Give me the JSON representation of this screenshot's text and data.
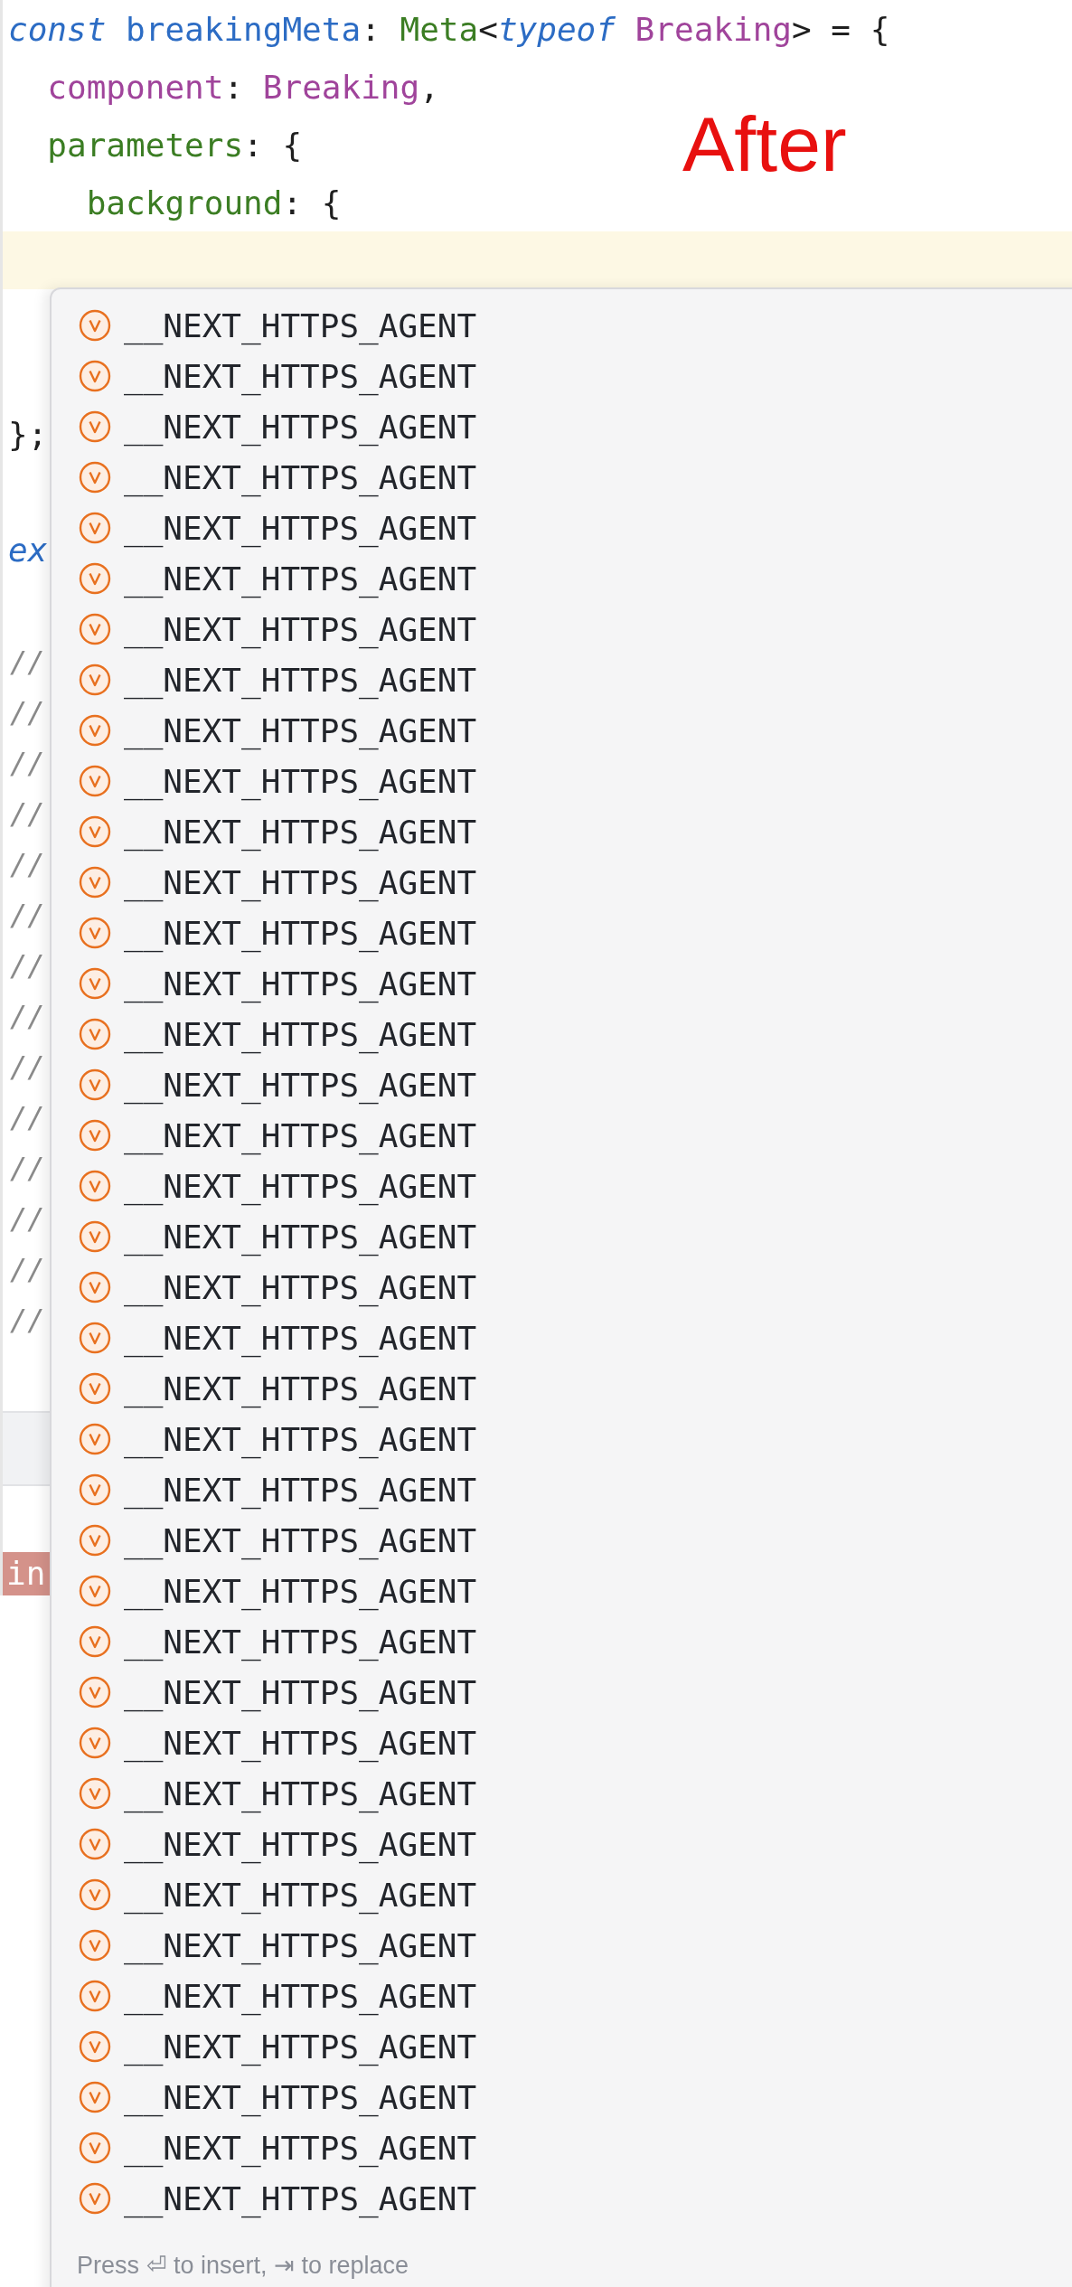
{
  "editor": {
    "code_lines": [
      {
        "current": false,
        "tokens": [
          {
            "text": "const ",
            "kind": "keyword"
          },
          {
            "text": "breakingMeta",
            "kind": "variable"
          },
          {
            "text": ": ",
            "kind": "punct"
          },
          {
            "text": "Meta",
            "kind": "type"
          },
          {
            "text": "<",
            "kind": "punct"
          },
          {
            "text": "typeof ",
            "kind": "keyword"
          },
          {
            "text": "Breaking",
            "kind": "field"
          },
          {
            "text": "> = {",
            "kind": "punct"
          }
        ]
      },
      {
        "current": false,
        "tokens": [
          {
            "text": "  component",
            "kind": "field"
          },
          {
            "text": ": ",
            "kind": "punct"
          },
          {
            "text": "Breaking",
            "kind": "field"
          },
          {
            "text": ",",
            "kind": "punct"
          }
        ]
      },
      {
        "current": false,
        "tokens": [
          {
            "text": "  parameters",
            "kind": "property"
          },
          {
            "text": ": {",
            "kind": "punct"
          }
        ]
      },
      {
        "current": false,
        "tokens": [
          {
            "text": "    background",
            "kind": "property"
          },
          {
            "text": ": {",
            "kind": "punct"
          }
        ]
      },
      {
        "current": true
      },
      {
        "current": false
      },
      {
        "current": false
      },
      {
        "current": false,
        "tokens": [
          {
            "text": "};",
            "kind": "punct"
          }
        ]
      },
      {
        "current": false
      },
      {
        "current": false,
        "tokens": [
          {
            "text": "ex",
            "kind": "keyword"
          }
        ]
      },
      {
        "current": false
      }
    ],
    "comment_lines": [
      "//",
      "//",
      "//",
      "//",
      "//",
      "//",
      "//",
      "//",
      "//",
      "//",
      "//",
      "//",
      "//",
      "//"
    ],
    "badge": "in"
  },
  "annotation": "After",
  "completion_popup": {
    "items": [
      {
        "label": "__NEXT_HTTPS_AGENT",
        "kind": "variable"
      },
      {
        "label": "__NEXT_HTTPS_AGENT",
        "kind": "variable"
      },
      {
        "label": "__NEXT_HTTPS_AGENT",
        "kind": "variable"
      },
      {
        "label": "__NEXT_HTTPS_AGENT",
        "kind": "variable"
      },
      {
        "label": "__NEXT_HTTPS_AGENT",
        "kind": "variable"
      },
      {
        "label": "__NEXT_HTTPS_AGENT",
        "kind": "variable"
      },
      {
        "label": "__NEXT_HTTPS_AGENT",
        "kind": "variable"
      },
      {
        "label": "__NEXT_HTTPS_AGENT",
        "kind": "variable"
      },
      {
        "label": "__NEXT_HTTPS_AGENT",
        "kind": "variable"
      },
      {
        "label": "__NEXT_HTTPS_AGENT",
        "kind": "variable"
      },
      {
        "label": "__NEXT_HTTPS_AGENT",
        "kind": "variable"
      },
      {
        "label": "__NEXT_HTTPS_AGENT",
        "kind": "variable"
      },
      {
        "label": "__NEXT_HTTPS_AGENT",
        "kind": "variable"
      },
      {
        "label": "__NEXT_HTTPS_AGENT",
        "kind": "variable"
      },
      {
        "label": "__NEXT_HTTPS_AGENT",
        "kind": "variable"
      },
      {
        "label": "__NEXT_HTTPS_AGENT",
        "kind": "variable"
      },
      {
        "label": "__NEXT_HTTPS_AGENT",
        "kind": "variable"
      },
      {
        "label": "__NEXT_HTTPS_AGENT",
        "kind": "variable"
      },
      {
        "label": "__NEXT_HTTPS_AGENT",
        "kind": "variable"
      },
      {
        "label": "__NEXT_HTTPS_AGENT",
        "kind": "variable"
      },
      {
        "label": "__NEXT_HTTPS_AGENT",
        "kind": "variable"
      },
      {
        "label": "__NEXT_HTTPS_AGENT",
        "kind": "variable"
      },
      {
        "label": "__NEXT_HTTPS_AGENT",
        "kind": "variable"
      },
      {
        "label": "__NEXT_HTTPS_AGENT",
        "kind": "variable"
      },
      {
        "label": "__NEXT_HTTPS_AGENT",
        "kind": "variable"
      },
      {
        "label": "__NEXT_HTTPS_AGENT",
        "kind": "variable"
      },
      {
        "label": "__NEXT_HTTPS_AGENT",
        "kind": "variable"
      },
      {
        "label": "__NEXT_HTTPS_AGENT",
        "kind": "variable"
      },
      {
        "label": "__NEXT_HTTPS_AGENT",
        "kind": "variable"
      },
      {
        "label": "__NEXT_HTTPS_AGENT",
        "kind": "variable"
      },
      {
        "label": "__NEXT_HTTPS_AGENT",
        "kind": "variable"
      },
      {
        "label": "__NEXT_HTTPS_AGENT",
        "kind": "variable"
      },
      {
        "label": "__NEXT_HTTPS_AGENT",
        "kind": "variable"
      },
      {
        "label": "__NEXT_HTTPS_AGENT",
        "kind": "variable"
      },
      {
        "label": "__NEXT_HTTPS_AGENT",
        "kind": "variable"
      },
      {
        "label": "__NEXT_HTTPS_AGENT",
        "kind": "variable"
      },
      {
        "label": "__NEXT_HTTPS_AGENT",
        "kind": "variable"
      },
      {
        "label": "__NEXT_HTTPS_AGENT",
        "kind": "variable"
      }
    ],
    "hint": "Press ⏎ to insert, ⇥ to replace"
  }
}
